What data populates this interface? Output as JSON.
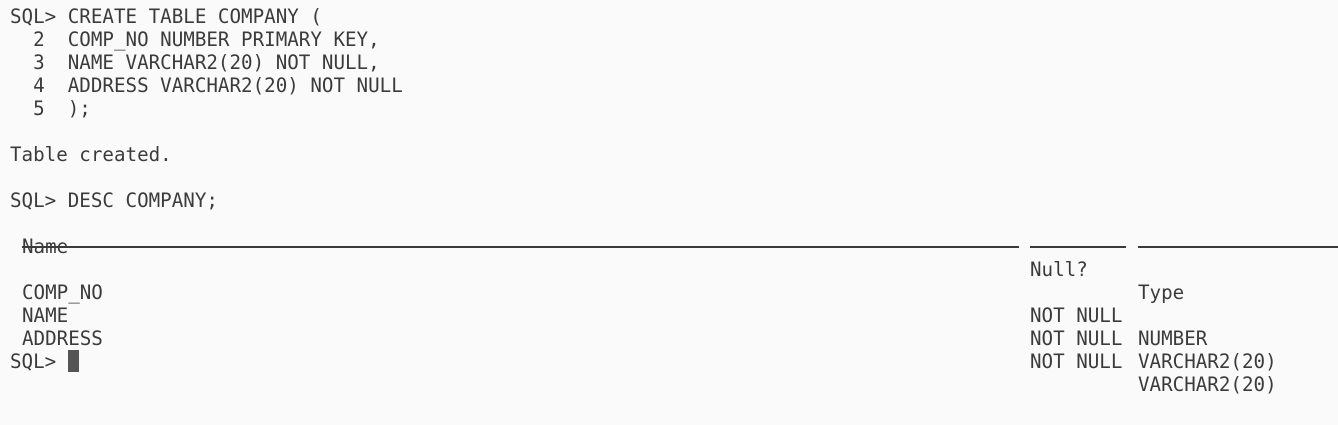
{
  "terminal": {
    "prompt": "SQL> ",
    "create_lines": [
      "SQL> CREATE TABLE COMPANY (",
      "  2  COMP_NO NUMBER PRIMARY KEY,",
      "  3  NAME VARCHAR2(20) NOT NULL,",
      "  4  ADDRESS VARCHAR2(20) NOT NULL",
      "  5  );"
    ],
    "create_result": "Table created.",
    "desc_command": "SQL> DESC COMPANY;",
    "desc_headers": {
      "name": "Name",
      "null": "Null?",
      "type": "Type"
    },
    "desc_rows": [
      {
        "name": "COMP_NO",
        "null": "NOT NULL",
        "type": "NUMBER"
      },
      {
        "name": "NAME",
        "null": "NOT NULL",
        "type": "VARCHAR2(20)"
      },
      {
        "name": "ADDRESS",
        "null": "NOT NULL",
        "type": "VARCHAR2(20)"
      }
    ],
    "cursor_color": "#555555",
    "background_color": "#fafafa",
    "text_color": "#3b3b3b"
  }
}
